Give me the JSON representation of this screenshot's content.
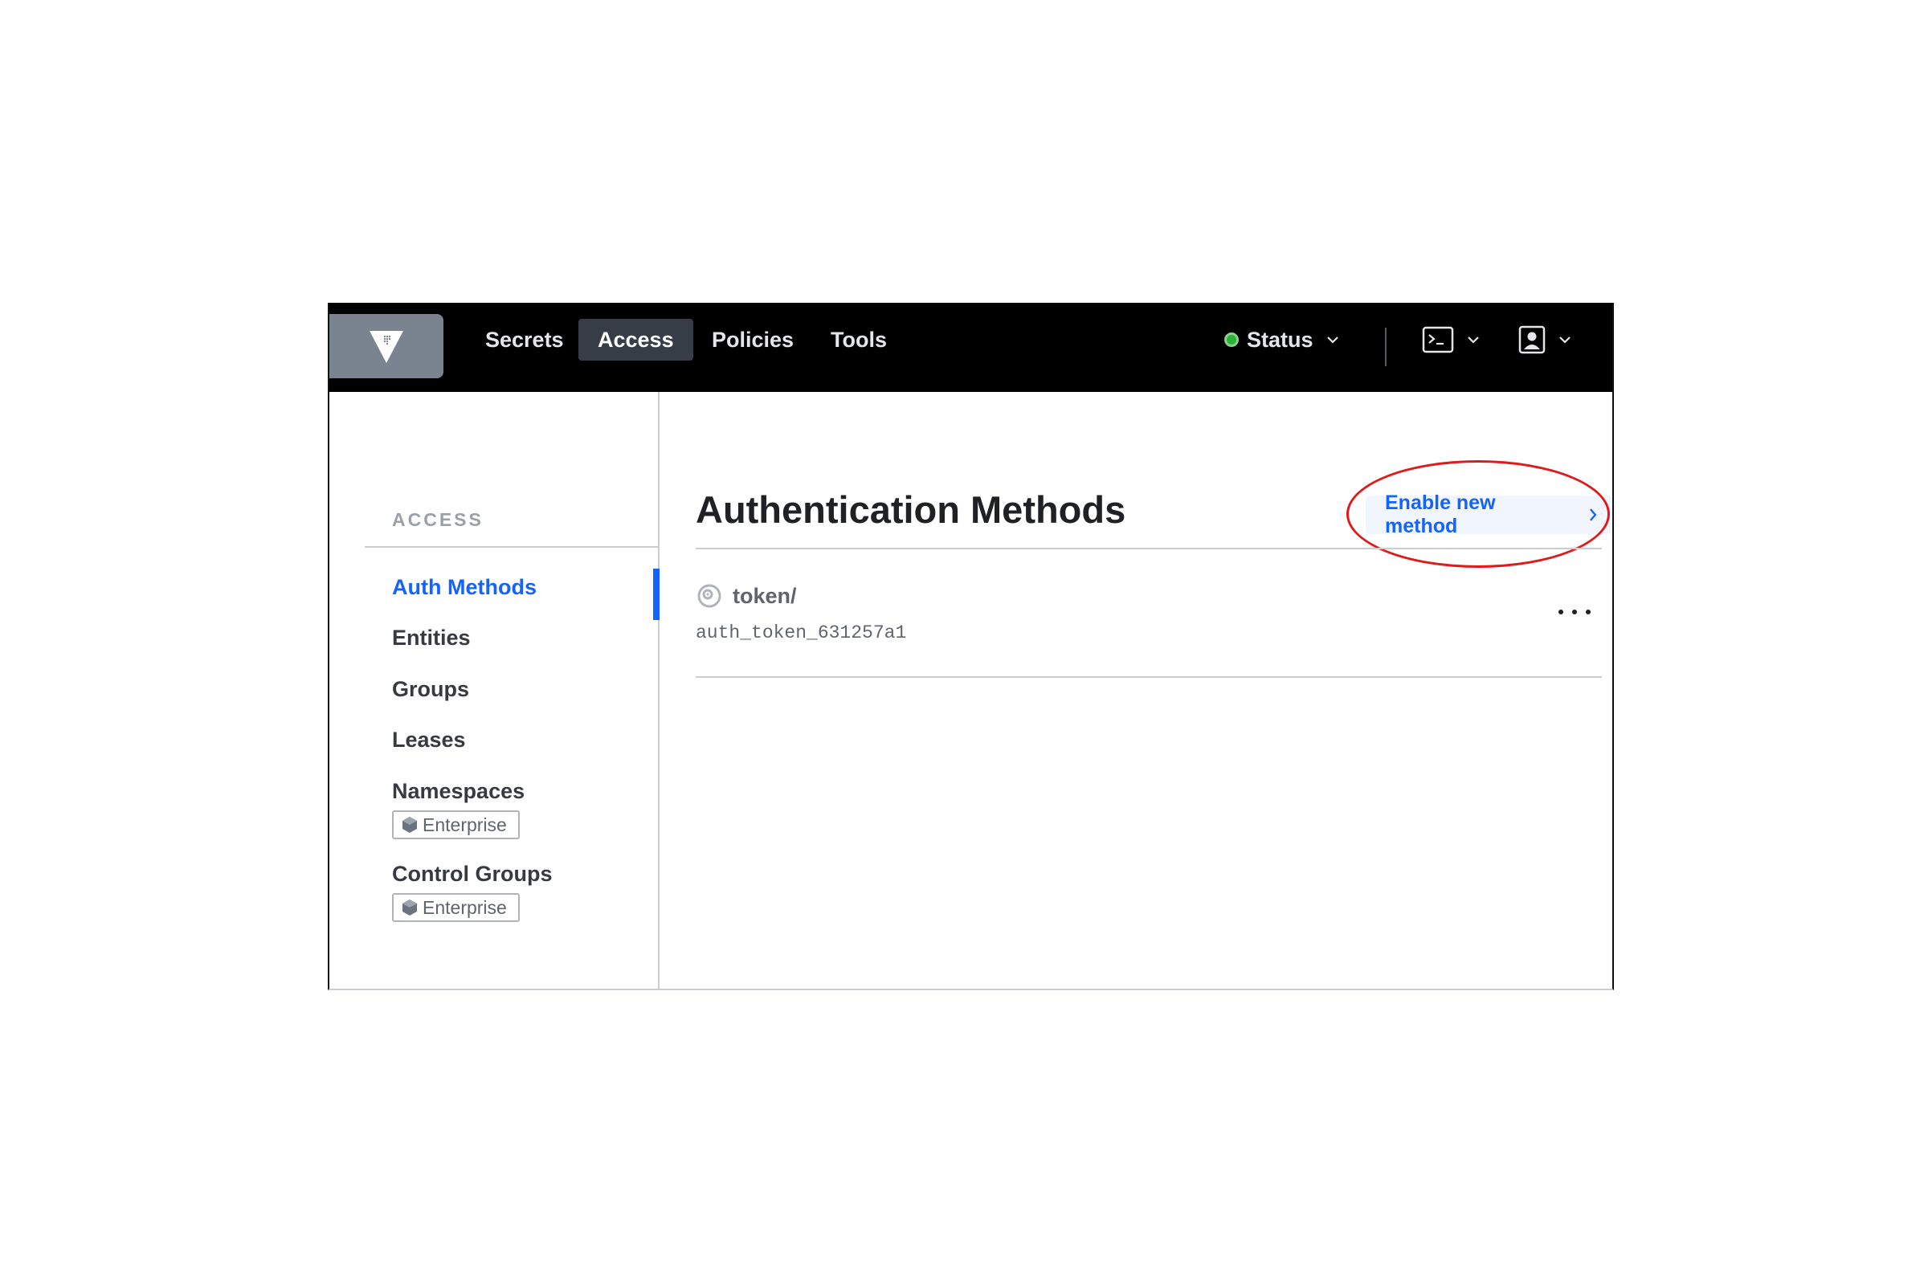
{
  "nav": {
    "items": [
      {
        "label": "Secrets"
      },
      {
        "label": "Access"
      },
      {
        "label": "Policies"
      },
      {
        "label": "Tools"
      }
    ],
    "status_label": "Status"
  },
  "sidebar": {
    "header": "ACCESS",
    "items": [
      {
        "label": "Auth Methods",
        "active": true
      },
      {
        "label": "Entities"
      },
      {
        "label": "Groups"
      },
      {
        "label": "Leases"
      },
      {
        "label": "Namespaces",
        "badge": "Enterprise"
      },
      {
        "label": "Control Groups",
        "badge": "Enterprise"
      }
    ]
  },
  "main": {
    "title": "Authentication Methods",
    "enable_label": "Enable new method",
    "rows": [
      {
        "name": "token/",
        "accessor": "auth_token_631257a1"
      }
    ]
  },
  "colors": {
    "accent": "#1563ff",
    "topbar": "#000000",
    "status_ok": "#2eb039",
    "annotation": "#e01a1a"
  },
  "icons": [
    "vault-logo-icon",
    "status-dot-icon",
    "chevron-down-icon",
    "terminal-icon",
    "user-icon",
    "token-icon",
    "chevron-right-icon",
    "more-icon",
    "enterprise-icon"
  ]
}
